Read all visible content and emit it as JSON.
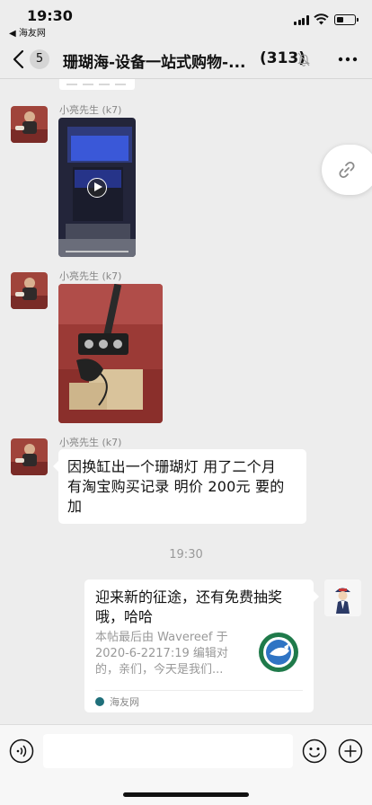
{
  "status_bar": {
    "time": "19:30",
    "back_app": "◀ 海友网",
    "icons": [
      "signal-icon",
      "wifi-icon",
      "battery-icon"
    ]
  },
  "nav": {
    "back_icon": "chevron-left-icon",
    "unread_count": "5",
    "title": "珊瑚海-设备一站式购物-...",
    "member_count": "(313)",
    "mute_icon": "bell-off-icon",
    "more_icon": "ellipsis-icon"
  },
  "messages": [
    {
      "type": "video",
      "sender": "小亮先生 (k7)"
    },
    {
      "type": "image",
      "sender": "小亮先生 (k7)"
    },
    {
      "type": "text",
      "sender": "小亮先生 (k7)",
      "lines": [
        "因换缸出一个珊瑚灯 用了二个月",
        "有淘宝购买记录 明价 200元 要的",
        "加"
      ]
    },
    {
      "type": "timestamp",
      "text": "19:30"
    },
    {
      "type": "link-card",
      "title_lines": [
        "迎来新的征途，还有免费抽奖",
        "哦，哈哈"
      ],
      "desc_lines": [
        "本帖最后由 Wavereef 于",
        "2020-6-2217:19 编辑对",
        "的，亲们，今天是我们..."
      ],
      "source": "海友网"
    }
  ],
  "floating_button_icon": "link-icon",
  "input_bar": {
    "voice_icon": "voice-icon",
    "emoji_icon": "emoji-icon",
    "add_icon": "plus-circle-icon"
  },
  "colors": {
    "background": "#ededed",
    "bubble": "#ffffff",
    "timestamp": "#999999"
  }
}
